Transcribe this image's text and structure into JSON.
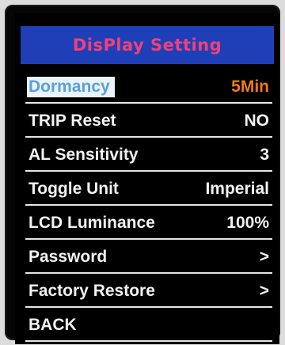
{
  "title": "DisPlay Setting",
  "items": [
    {
      "label": "Dormancy",
      "value": "5Min"
    },
    {
      "label": "TRIP Reset",
      "value": "NO"
    },
    {
      "label": "AL Sensitivity",
      "value": "3"
    },
    {
      "label": "Toggle Unit",
      "value": "Imperial"
    },
    {
      "label": "LCD Luminance",
      "value": "100%"
    },
    {
      "label": "Password",
      "value": ">"
    },
    {
      "label": "Factory Restore",
      "value": ">"
    },
    {
      "label": "BACK",
      "value": ""
    }
  ],
  "selected_item": "Dormancy",
  "colors": {
    "background": "#000000",
    "title_bar": "#1f3fb8",
    "title_text": "#f04078",
    "text": "#f2f2f2",
    "selected_highlight": "#eaf4ff",
    "selected_text": "#5aa0d8",
    "value_accent": "#f07a1a"
  }
}
